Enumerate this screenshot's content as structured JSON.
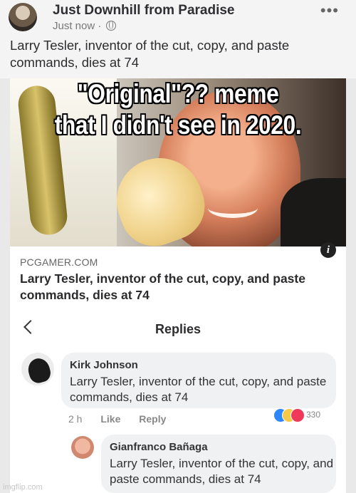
{
  "post": {
    "page_name": "Just Downhill from Paradise",
    "timestamp": "Just now",
    "separator": "·",
    "privacy_icon": "globe-icon",
    "more_icon": "more-options-icon",
    "more_glyph": "•••",
    "text": "Larry Tesler, inventor of the cut, copy, and paste commands, dies at 74"
  },
  "meme": {
    "caption_line1": "\"Original\"?? meme",
    "caption_line2": "that I didn't see in 2020."
  },
  "link_preview": {
    "domain": "PCGAMER.COM",
    "title": "Larry Tesler, inventor of the cut, copy, and paste commands, dies at 74",
    "info_glyph": "i"
  },
  "replies": {
    "back_icon": "chevron-left-icon",
    "title": "Replies",
    "comments": [
      {
        "author": "Kirk Johnson",
        "text": "Larry Tesler, inventor of the cut, copy, and paste commands, dies at 74",
        "time": "2 h",
        "like_label": "Like",
        "reply_label": "Reply",
        "reaction_count": "330"
      },
      {
        "author": "Gianfranco Bañaga",
        "text": "Larry Tesler, inventor of the cut, copy, and paste commands, dies at 74"
      }
    ]
  },
  "watermark": "imgflip.com",
  "colors": {
    "like": "#2d88ff",
    "haha": "#f7c948",
    "love": "#f0385a"
  }
}
